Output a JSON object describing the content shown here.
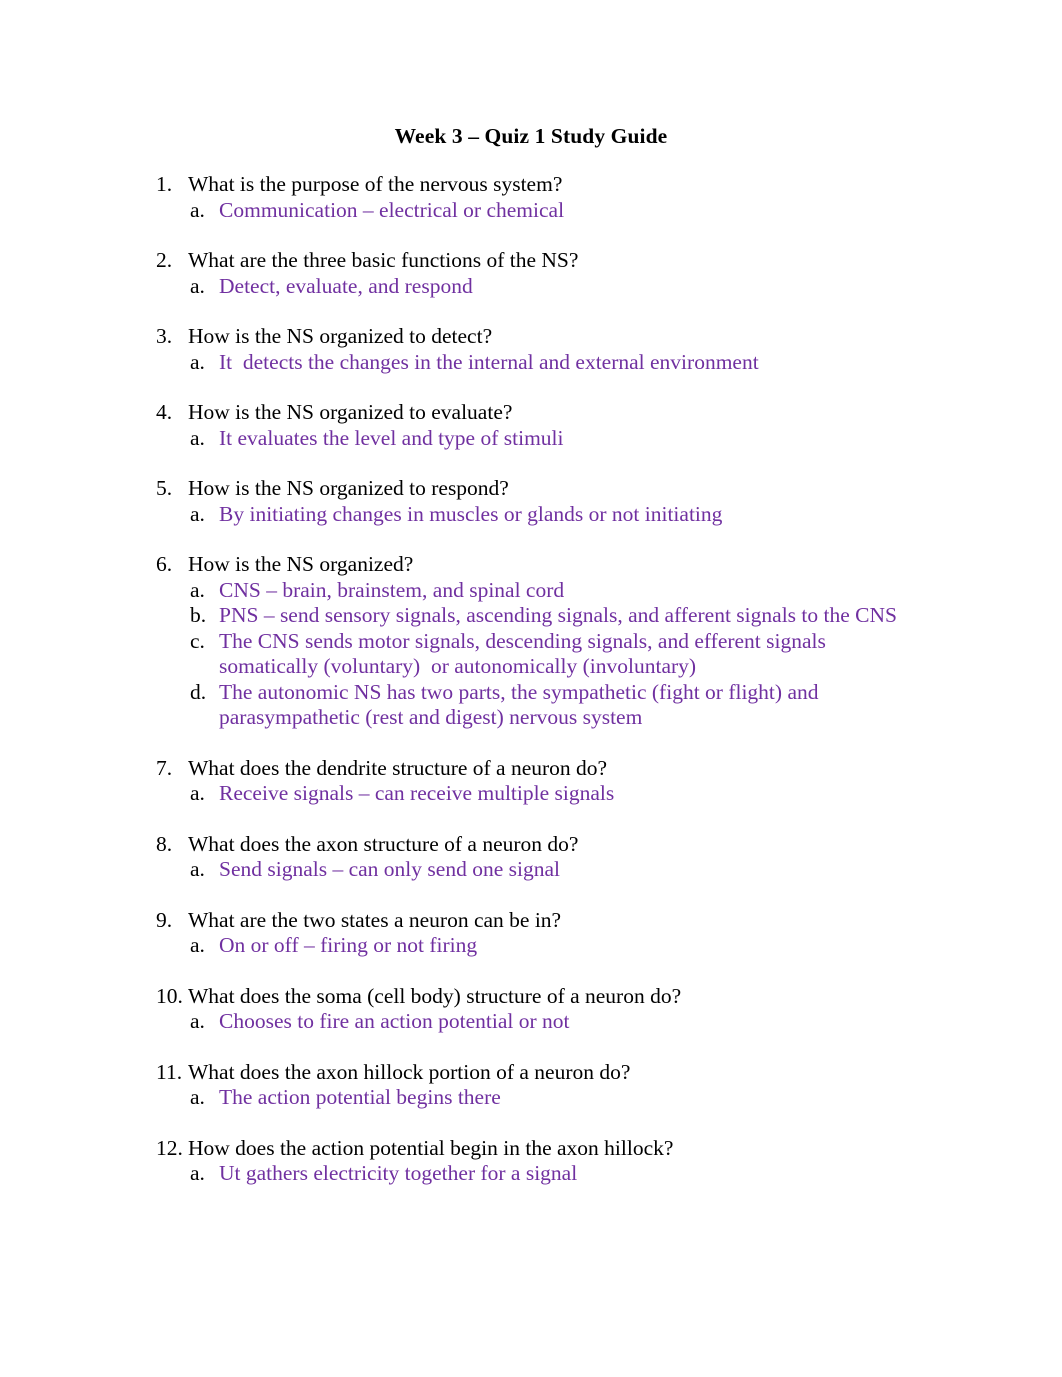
{
  "document": {
    "title": "Week 3 – Quiz 1 Study Guide",
    "answer_color": "#7030a0",
    "question_color": "#000000",
    "background_color": "#ffffff",
    "items": [
      {
        "number": "1.",
        "question": "What is the purpose of the nervous system?",
        "answers": [
          {
            "marker": "a.",
            "text": "Communication – electrical or chemical"
          }
        ]
      },
      {
        "number": "2.",
        "question": "What are the three basic functions of the NS?",
        "answers": [
          {
            "marker": "a.",
            "text": "Detect, evaluate, and respond"
          }
        ]
      },
      {
        "number": "3.",
        "question": "How is the NS organized to detect?",
        "answers": [
          {
            "marker": "a.",
            "text": "It  detects the changes in the internal and external environment"
          }
        ]
      },
      {
        "number": "4.",
        "question": "How is the NS organized to evaluate?",
        "answers": [
          {
            "marker": "a.",
            "text": "It evaluates the level and type of stimuli"
          }
        ]
      },
      {
        "number": "5.",
        "question": "How is the NS organized to respond?",
        "answers": [
          {
            "marker": "a.",
            "text": "By initiating changes in muscles or glands or not initiating"
          }
        ]
      },
      {
        "number": "6.",
        "question": "How is the NS organized?",
        "answers": [
          {
            "marker": "a.",
            "text": "CNS – brain, brainstem, and spinal cord"
          },
          {
            "marker": "b.",
            "text": "PNS – send sensory signals, ascending signals, and afferent signals to the CNS"
          },
          {
            "marker": "c.",
            "text": "The CNS sends motor signals, descending signals, and efferent signals somatically (voluntary)  or autonomically (involuntary)"
          },
          {
            "marker": "d.",
            "text": "The autonomic NS has two parts, the sympathetic (fight or flight) and parasympathetic (rest and digest) nervous system"
          }
        ]
      },
      {
        "number": "7.",
        "question": "What does the dendrite structure of a neuron do?",
        "answers": [
          {
            "marker": "a.",
            "text": "Receive signals – can receive multiple signals"
          }
        ]
      },
      {
        "number": "8.",
        "question": "What does the axon structure of a neuron do?",
        "answers": [
          {
            "marker": "a.",
            "text": "Send signals – can only send one signal"
          }
        ]
      },
      {
        "number": "9.",
        "question": "What are the two states a neuron can be in?",
        "answers": [
          {
            "marker": "a.",
            "text": "On or off – firing or not firing"
          }
        ]
      },
      {
        "number": "10.",
        "question": "What does the soma (cell body) structure of a neuron do?",
        "answers": [
          {
            "marker": "a.",
            "text": "Chooses to fire an action potential or not"
          }
        ]
      },
      {
        "number": "11.",
        "question": "What does the axon hillock portion of a neuron do?",
        "answers": [
          {
            "marker": "a.",
            "text": "The action potential begins there"
          }
        ]
      },
      {
        "number": "12.",
        "question": "How does the action potential begin in the axon hillock?",
        "answers": [
          {
            "marker": "a.",
            "text": "Ut gathers electricity together for a signal"
          }
        ]
      }
    ]
  }
}
